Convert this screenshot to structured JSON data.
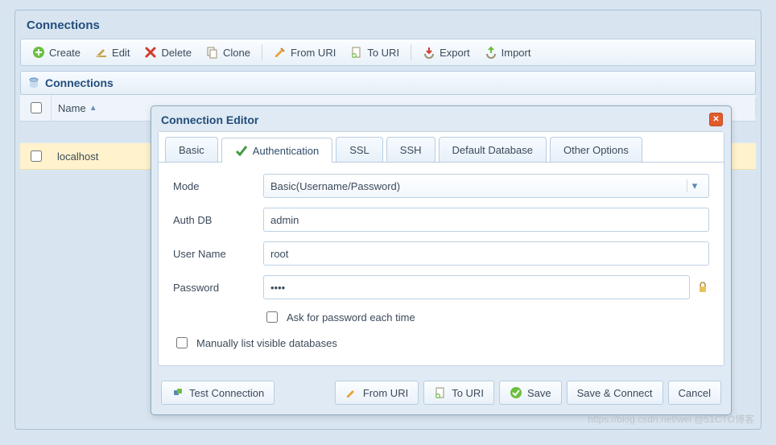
{
  "watermark": "https://blog.csdn.net/wei  @51CTO博客",
  "panel": {
    "title": "Connections",
    "sub_title": "Connections",
    "toolbar": {
      "create": "Create",
      "edit": "Edit",
      "delete": "Delete",
      "clone": "Clone",
      "from_uri": "From URI",
      "to_uri": "To URI",
      "export": "Export",
      "import": "Import"
    },
    "grid": {
      "col_name": "Name",
      "rows": [
        {
          "name": ""
        },
        {
          "name": "localhost",
          "selected": true
        }
      ]
    }
  },
  "editor": {
    "title": "Connection Editor",
    "tabs": {
      "basic": "Basic",
      "auth": "Authentication",
      "ssl": "SSL",
      "ssh": "SSH",
      "default_db": "Default Database",
      "other": "Other Options"
    },
    "form": {
      "mode_label": "Mode",
      "mode_value": "Basic(Username/Password)",
      "authdb_label": "Auth DB",
      "authdb_value": "admin",
      "user_label": "User Name",
      "user_value": "root",
      "pwd_label": "Password",
      "pwd_value": "••••",
      "ask_pwd_label": "Ask for password each time",
      "manual_dbs_label": "Manually list visible databases"
    },
    "footer": {
      "test": "Test Connection",
      "from_uri": "From URI",
      "to_uri": "To URI",
      "save": "Save",
      "save_connect": "Save & Connect",
      "cancel": "Cancel"
    }
  },
  "colors": {
    "accent_blue": "#234d7a",
    "selected_row": "#fff2cc",
    "close_btn": "#e25b2b"
  }
}
